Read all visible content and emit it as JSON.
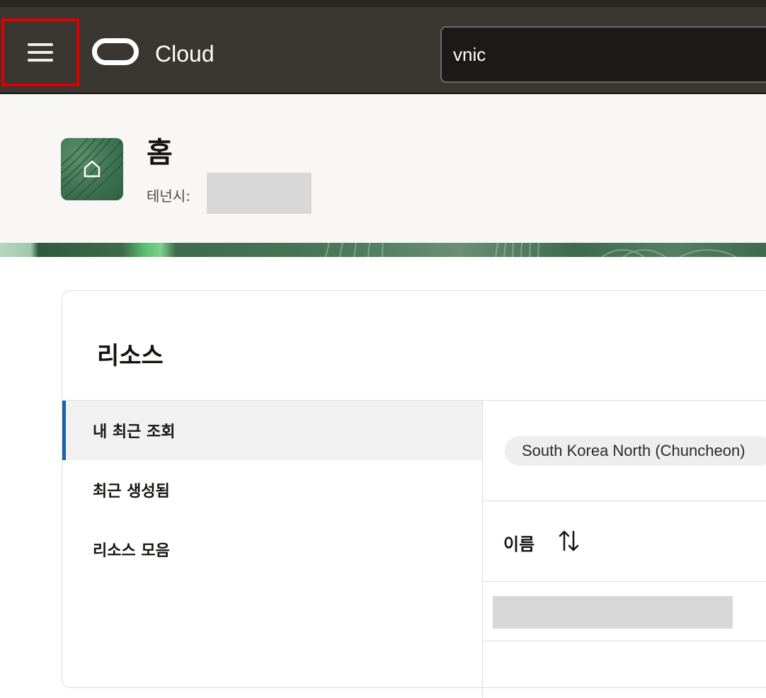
{
  "header": {
    "brand": "Cloud",
    "search": {
      "value": "vnic"
    }
  },
  "page": {
    "title": "홈",
    "tenant_label": "테넌시:"
  },
  "resources": {
    "title": "리소스",
    "nav": [
      {
        "label": "내 최근 조회",
        "active": true
      },
      {
        "label": "최근 생성됨",
        "active": false
      },
      {
        "label": "리소스 모음",
        "active": false
      }
    ],
    "region_filter": "South Korea North (Chuncheon)",
    "columns": [
      {
        "label": "이름",
        "sortable": true
      }
    ]
  },
  "colors": {
    "topbar": "#3a3631",
    "highlight": "#e00000",
    "active_accent": "#1a62a6",
    "tile_green": "#3c7150"
  }
}
